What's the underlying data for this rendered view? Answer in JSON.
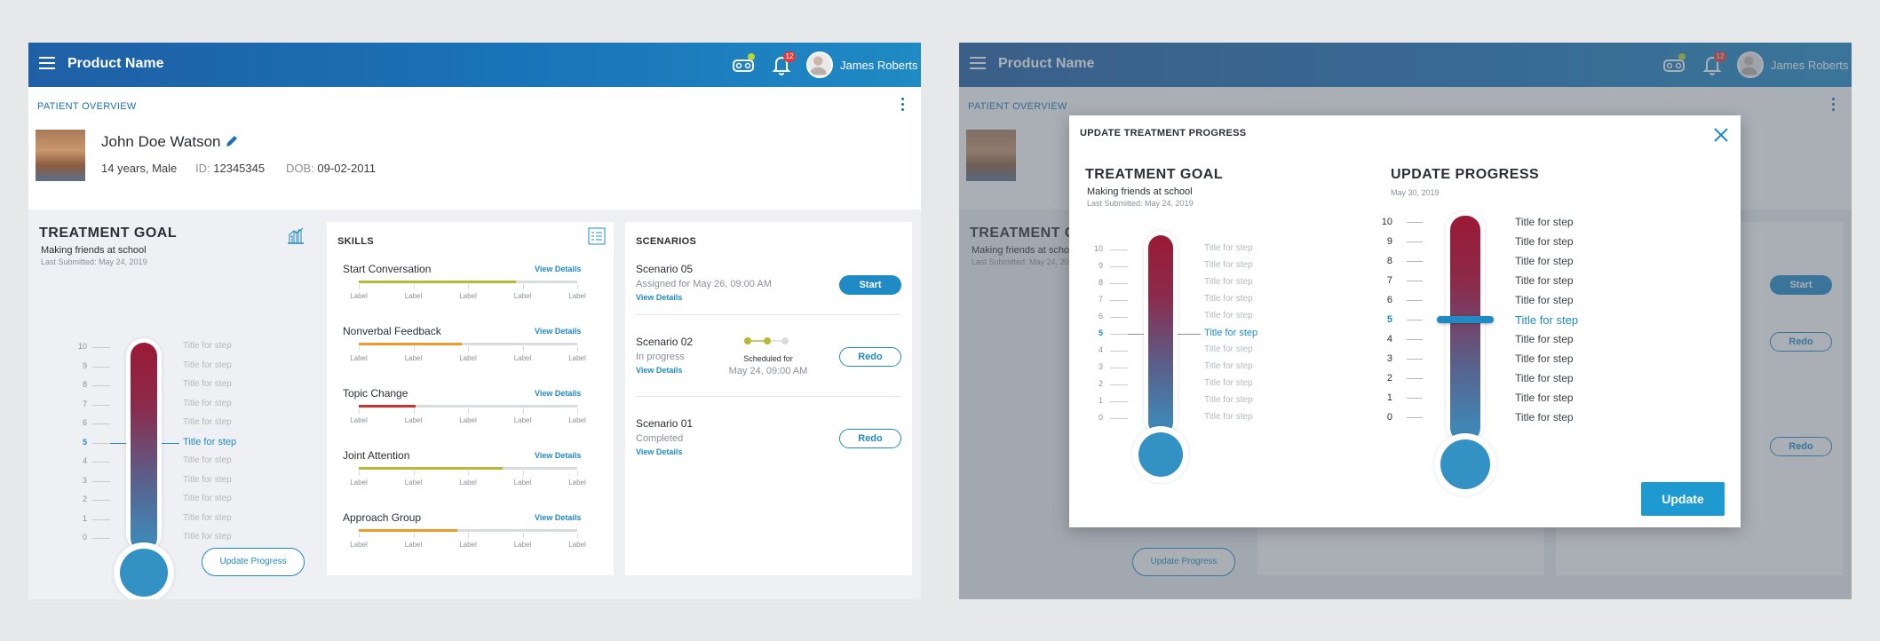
{
  "app": {
    "product_name": "Product Name",
    "user_name": "James Roberts",
    "notification_count": "12",
    "accent_color": "#1f8ac4"
  },
  "overview": {
    "section_title": "PATIENT OVERVIEW",
    "patient_name": "John Doe Watson",
    "age_gender": "14 years, Male",
    "id_label": "ID:",
    "id_value": "12345345",
    "dob_label": "DOB:",
    "dob_value": "09-02-2011"
  },
  "treatment_goal": {
    "title": "TREATMENT GOAL",
    "goal": "Making friends at school",
    "last_submitted": "Last Submitted: May 24, 2019",
    "level": 5,
    "scale": [
      "10",
      "9",
      "8",
      "7",
      "6",
      "5",
      "4",
      "3",
      "2",
      "1",
      "0"
    ],
    "steps": [
      "Title for step",
      "Title for step",
      "Title for step",
      "Title for step",
      "Title for step",
      "Title for step",
      "Title for step",
      "Title for step",
      "Title for step",
      "Title for step",
      "Title for step"
    ],
    "update_button": "Update Progress"
  },
  "skills": {
    "title": "SKILLS",
    "view_details": "View Details",
    "tick_label": "Label",
    "items": [
      {
        "name": "Start Conversation",
        "progress": 0.72,
        "color": "#b7b934"
      },
      {
        "name": "Nonverbal Feedback",
        "progress": 0.47,
        "color": "#ef9a2c"
      },
      {
        "name": "Topic Change",
        "progress": 0.26,
        "color": "#c9332d"
      },
      {
        "name": "Joint Attention",
        "progress": 0.66,
        "color": "#b7b934"
      },
      {
        "name": "Approach Group",
        "progress": 0.45,
        "color": "#ef9a2c"
      }
    ]
  },
  "scenarios": {
    "title": "SCENARIOS",
    "view_details": "View Details",
    "items": [
      {
        "name": "Scenario 05",
        "status": "Assigned for May 26, 09:00 AM",
        "action": "Start"
      },
      {
        "name": "Scenario 02",
        "status": "In progress",
        "scheduled_label": "Scheduled for",
        "scheduled_date": "May 24, 09:00 AM",
        "action": "Redo"
      },
      {
        "name": "Scenario 01",
        "status": "Completed",
        "action": "Redo"
      }
    ]
  },
  "modal": {
    "title": "UPDATE TREATMENT PROGRESS",
    "goal_title": "TREATMENT GOAL",
    "goal": "Making friends at school",
    "last_submitted": "Last Submitted: May 24, 2019",
    "progress_title": "UPDATE PROGRESS",
    "progress_date": "May 30, 2019",
    "update_button": "Update",
    "new_level": 5
  }
}
